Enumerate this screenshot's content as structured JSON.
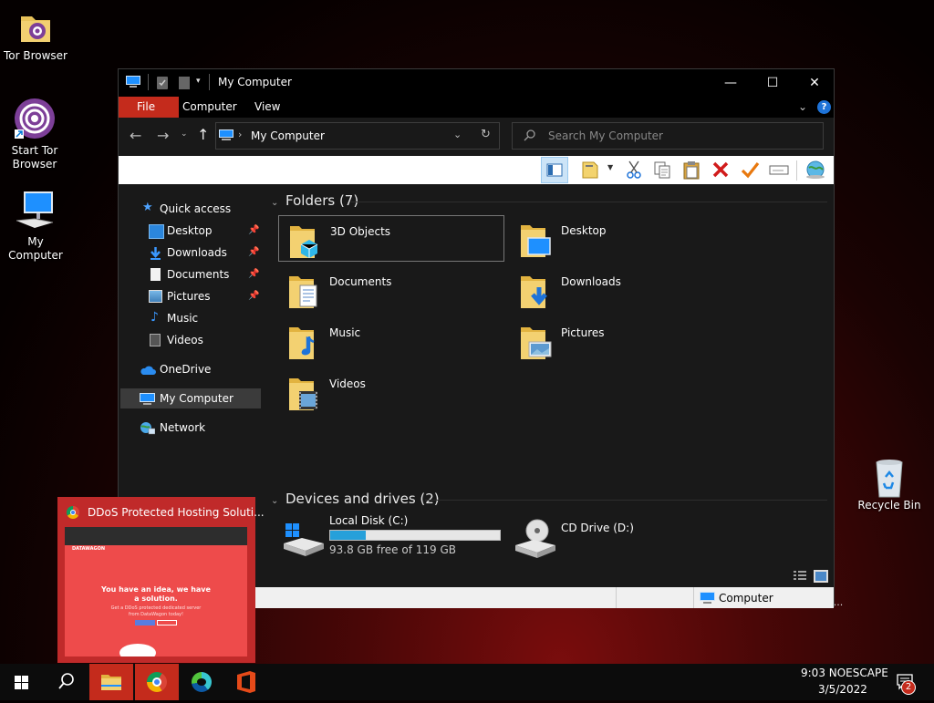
{
  "desktop": {
    "icons": [
      {
        "label": "Tor Browser",
        "icon": "folder-tor-icon"
      },
      {
        "label": "Start Tor Browser",
        "icon": "tor-onion-icon"
      },
      {
        "label": "My Computer",
        "icon": "computer-icon"
      },
      {
        "label": "Recycle Bin",
        "icon": "recycle-bin-icon"
      }
    ],
    "stray_text": "en..."
  },
  "window": {
    "title": "My Computer",
    "ribbon_tabs": [
      "File",
      "Computer",
      "View"
    ],
    "address": "My Computer",
    "search_placeholder": "Search My Computer",
    "help": "?",
    "colors": {
      "file_tab": "#c42b1c",
      "accent": "#0078d7",
      "window_bg": "#191919"
    }
  },
  "sidebar": {
    "quick_access": "Quick access",
    "pinned": [
      {
        "label": "Desktop",
        "pinned": true
      },
      {
        "label": "Downloads",
        "pinned": true
      },
      {
        "label": "Documents",
        "pinned": true
      },
      {
        "label": "Pictures",
        "pinned": true
      },
      {
        "label": "Music",
        "pinned": false
      },
      {
        "label": "Videos",
        "pinned": false
      }
    ],
    "onedrive": "OneDrive",
    "my_computer": "My Computer",
    "network": "Network"
  },
  "content": {
    "folders_header": "Folders (7)",
    "folders": [
      "3D Objects",
      "Desktop",
      "Documents",
      "Downloads",
      "Music",
      "Pictures",
      "Videos"
    ],
    "devices_header": "Devices and drives (2)",
    "drives": [
      {
        "name": "Local Disk (C:)",
        "free_text": "93.8 GB free of 119 GB",
        "used_fraction": 0.21
      },
      {
        "name": "CD Drive (D:)"
      }
    ]
  },
  "details_bar": {
    "label": "Computer"
  },
  "preview": {
    "title": "DDoS Protected Hosting Soluti...",
    "headline": "You have an idea, we have a solution.",
    "sub": "Get a DDoS protected dedicated server from DataWagon today!",
    "brand": "DATAWAGON"
  },
  "taskbar": {
    "time": "9:03 NOESCAPE",
    "date": "3/5/2022",
    "notification_count": "2"
  }
}
